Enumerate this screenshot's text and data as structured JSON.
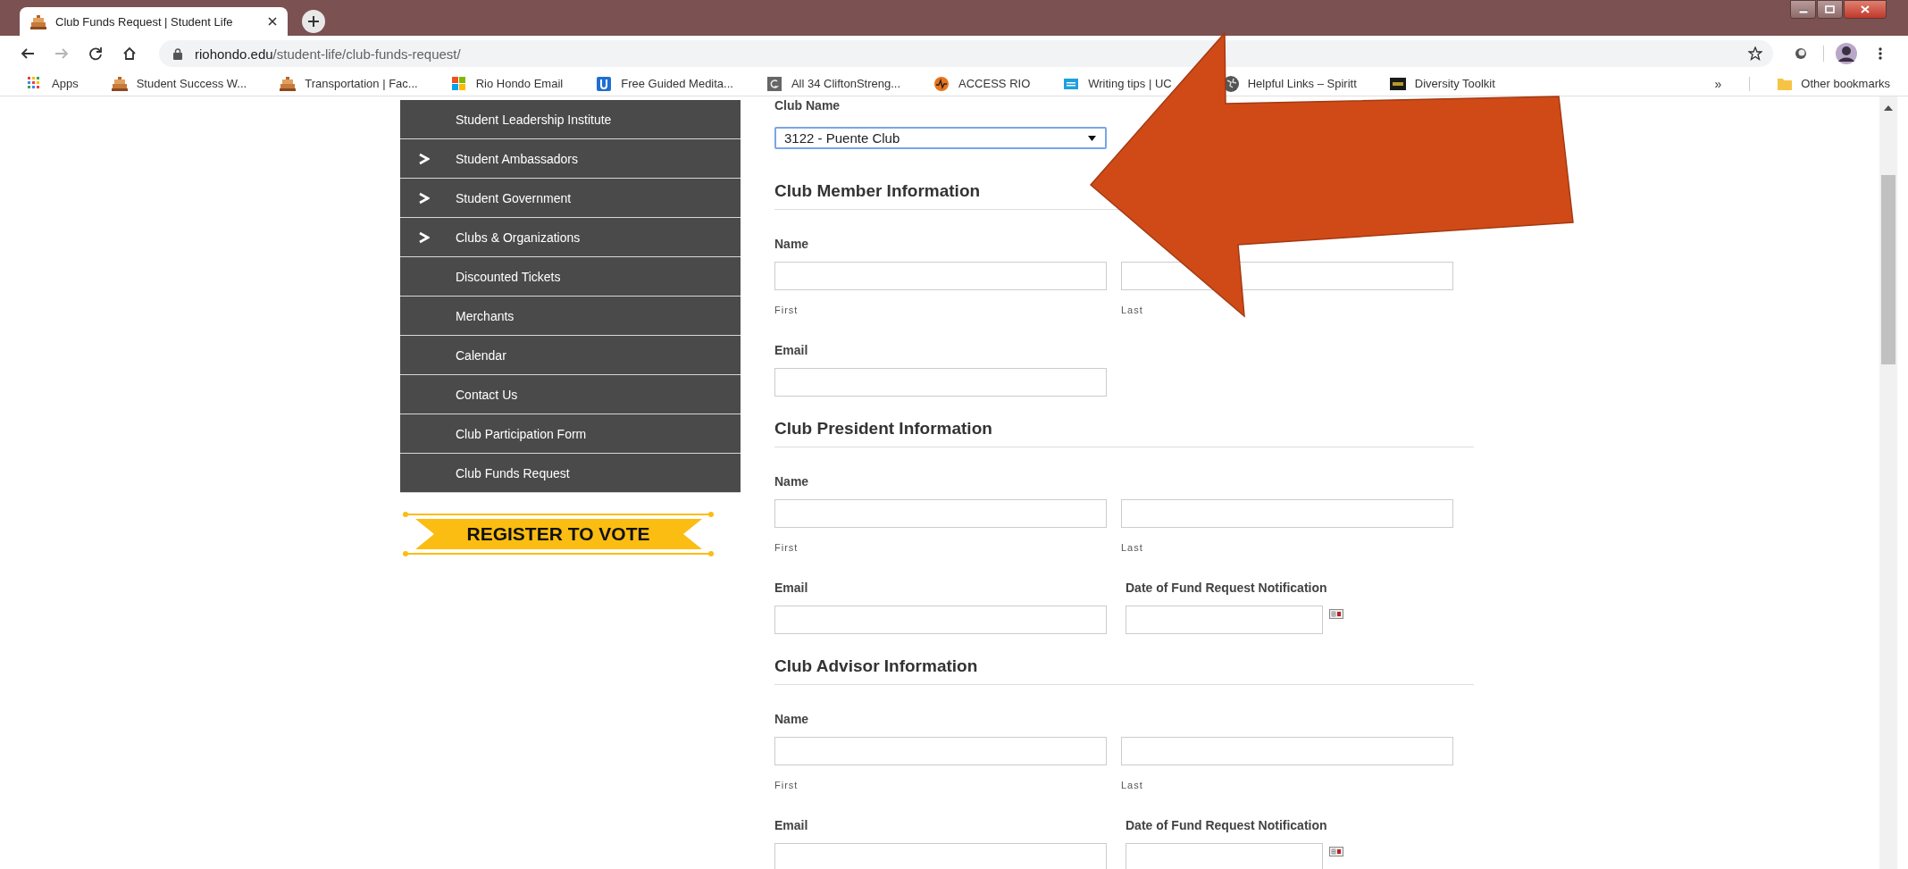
{
  "browser": {
    "tabs": [
      {
        "title": "Club Funds Request | Student Life",
        "selected": true
      }
    ],
    "nav_buttons": [
      {
        "kind": "back",
        "disabled": false
      },
      {
        "kind": "forward",
        "disabled": true
      },
      {
        "kind": "reload",
        "disabled": false
      },
      {
        "kind": "home",
        "disabled": false
      }
    ],
    "address": {
      "host": "riohondo.edu",
      "path": "/student-life/club-funds-request/"
    },
    "bookmarks": [
      {
        "kind": "apps",
        "label": "Apps"
      },
      {
        "kind": "campus",
        "label": "Student Success W..."
      },
      {
        "kind": "campus",
        "label": "Transportation | Fac..."
      },
      {
        "kind": "windows",
        "label": "Rio Hondo Email"
      },
      {
        "kind": "u",
        "label": "Free Guided Medita..."
      },
      {
        "kind": "g",
        "label": "All 34 CliftonStreng..."
      },
      {
        "kind": "access",
        "label": "ACCESS RIO"
      },
      {
        "kind": "card",
        "label": "Writing tips | UC"
      },
      {
        "kind": "globe",
        "label": "Helpful Links – Spiritt"
      },
      {
        "kind": "usc",
        "label": "Diversity Toolkit"
      }
    ],
    "overflow": "»",
    "other_bookmarks": "Other bookmarks"
  },
  "sidebar": {
    "items": [
      {
        "label": "Student Leadership Institute",
        "has_submenu": false
      },
      {
        "label": "Student Ambassadors",
        "has_submenu": true
      },
      {
        "label": "Student Government",
        "has_submenu": true
      },
      {
        "label": "Clubs & Organizations",
        "has_submenu": true
      },
      {
        "label": "Discounted Tickets",
        "has_submenu": false
      },
      {
        "label": "Merchants",
        "has_submenu": false
      },
      {
        "label": "Calendar",
        "has_submenu": false
      },
      {
        "label": "Contact Us",
        "has_submenu": false
      },
      {
        "label": "Club Participation Form",
        "has_submenu": false
      },
      {
        "label": "Club Funds Request",
        "has_submenu": false
      }
    ]
  },
  "register_banner": "REGISTER TO VOTE",
  "form": {
    "club_name": {
      "label": "Club Name",
      "value": "3122 - Puente Club",
      "focused": true
    },
    "sections": [
      {
        "title": "Club Member Information",
        "rows": [
          [
            {
              "kind": "name",
              "label": "Name",
              "first": "First",
              "last": "Last"
            }
          ],
          [
            {
              "kind": "text",
              "label": "Email"
            }
          ]
        ]
      },
      {
        "title": "Club President Information",
        "rows": [
          [
            {
              "kind": "name",
              "label": "Name",
              "first": "First",
              "last": "Last"
            }
          ],
          [
            {
              "kind": "text",
              "label": "Email"
            },
            {
              "kind": "date",
              "label": "Date of Fund Request Notification"
            }
          ]
        ]
      },
      {
        "title": "Club Advisor Information",
        "rows": [
          [
            {
              "kind": "name",
              "label": "Name",
              "first": "First",
              "last": "Last"
            }
          ],
          [
            {
              "kind": "text",
              "label": "Email"
            },
            {
              "kind": "date",
              "label": "Date of Fund Request Notification"
            }
          ]
        ]
      }
    ]
  }
}
